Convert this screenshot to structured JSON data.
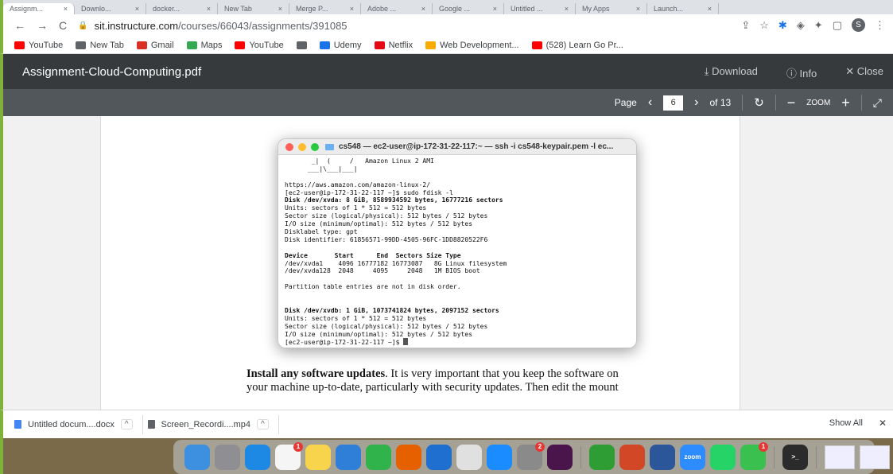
{
  "browser": {
    "tabs": [
      "Assignm...",
      "Downlo...",
      "docker...",
      "New Tab",
      "Merge P...",
      "Adobe ...",
      "Google ...",
      "Untitled ...",
      "My Apps",
      "Launch..."
    ],
    "url_domain": "sit.instructure.com",
    "url_path": "/courses/66043/assignments/391085",
    "avatar_letter": "S",
    "bookmarks": [
      {
        "label": "YouTube",
        "icon": "youtube-icon",
        "color": "#ff0000"
      },
      {
        "label": "New Tab",
        "icon": "chrome-icon",
        "color": "#5f6368"
      },
      {
        "label": "Gmail",
        "icon": "gmail-icon",
        "color": "#d93025"
      },
      {
        "label": "Maps",
        "icon": "maps-icon",
        "color": "#34a853"
      },
      {
        "label": "YouTube",
        "icon": "youtube-icon",
        "color": "#ff0000"
      },
      {
        "label": "",
        "icon": "chrome-icon",
        "color": "#5f6368"
      },
      {
        "label": "Udemy",
        "icon": "udemy-icon",
        "color": "#1a73e8"
      },
      {
        "label": "Netflix",
        "icon": "netflix-icon",
        "color": "#e50914"
      },
      {
        "label": "Web Development...",
        "icon": "bulb-icon",
        "color": "#f9ab00"
      },
      {
        "label": "(528) Learn Go Pr...",
        "icon": "youtube-icon",
        "color": "#ff0000"
      }
    ]
  },
  "viewer": {
    "title": "Assignment-Cloud-Computing.pdf",
    "download": "Download",
    "info": "Info",
    "close": "Close",
    "page_label": "Page",
    "page_current": "6",
    "page_total": "of 13",
    "zoom_label": "ZOOM"
  },
  "terminal": {
    "title": "cs548 — ec2-user@ip-172-31-22-117:~ — ssh -i cs548-keypair.pem -l ec...",
    "lines": [
      "       _|  (     /   Amazon Linux 2 AMI",
      "      ___|\\___|___|",
      "",
      "https://aws.amazon.com/amazon-linux-2/",
      "[ec2-user@ip-172-31-22-117 ~]$ sudo fdisk -l",
      "Disk /dev/xvda: 8 GiB, 8589934592 bytes, 16777216 sectors",
      "Units: sectors of 1 * 512 = 512 bytes",
      "Sector size (logical/physical): 512 bytes / 512 bytes",
      "I/O size (minimum/optimal): 512 bytes / 512 bytes",
      "Disklabel type: gpt",
      "Disk identifier: 61856571-99DD-4505-96FC-1DD8820522F6",
      "",
      "Device       Start      End  Sectors Size Type",
      "/dev/xvda1    4096 16777182 16773087   8G Linux filesystem",
      "/dev/xvda128  2048     4095     2048   1M BIOS boot",
      "",
      "Partition table entries are not in disk order.",
      "",
      "",
      "Disk /dev/xvdb: 1 GiB, 1073741824 bytes, 2097152 sectors",
      "Units: sectors of 1 * 512 = 512 bytes",
      "Sector size (logical/physical): 512 bytes / 512 bytes",
      "I/O size (minimum/optimal): 512 bytes / 512 bytes",
      "[ec2-user@ip-172-31-22-117 ~]$ "
    ],
    "bold_lines": [
      5,
      12,
      19
    ]
  },
  "document": {
    "bold_text": "Install any software updates",
    "text_line1": ".  It is very important that you keep the software on",
    "text_line2": "your machine up-to-date, particularly with security updates.  Then edit the mount"
  },
  "downloads": {
    "items": [
      {
        "label": "Untitled docum....docx",
        "color": "#4285f4"
      },
      {
        "label": "Screen_Recordi....mp4",
        "color": "#5f6368"
      }
    ],
    "show_all": "Show All"
  },
  "dock": {
    "apps": [
      {
        "name": "finder-icon",
        "color": "#3d8fe0",
        "label": ""
      },
      {
        "name": "launchpad-icon",
        "color": "#8e8e93",
        "label": ""
      },
      {
        "name": "safari-icon",
        "color": "#1e88e5",
        "label": ""
      },
      {
        "name": "reminders-icon",
        "color": "#f5f5f5",
        "label": "",
        "badge": "1"
      },
      {
        "name": "notes-icon",
        "color": "#f7d44c",
        "label": ""
      },
      {
        "name": "keynote-icon",
        "color": "#2f7fd8",
        "label": ""
      },
      {
        "name": "numbers-icon",
        "color": "#2fb34a",
        "label": ""
      },
      {
        "name": "firefox-icon",
        "color": "#e66000",
        "label": ""
      },
      {
        "name": "vscode-icon",
        "color": "#1e6fd0",
        "label": ""
      },
      {
        "name": "chrome-icon",
        "color": "#e0e0e0",
        "label": ""
      },
      {
        "name": "appstore-icon",
        "color": "#1a8cff",
        "label": ""
      },
      {
        "name": "system-settings-icon",
        "color": "#8a8a8a",
        "label": "",
        "badge": "2"
      },
      {
        "name": "slack-icon",
        "color": "#4a154b",
        "label": ""
      },
      {
        "name": "utorrent-icon",
        "color": "#2e9e34",
        "label": ""
      },
      {
        "name": "powerpoint-icon",
        "color": "#d24726",
        "label": ""
      },
      {
        "name": "word-icon",
        "color": "#2b579a",
        "label": ""
      },
      {
        "name": "zoom-icon",
        "color": "#2d8cff",
        "label": "zoom"
      },
      {
        "name": "whatsapp-icon",
        "color": "#25d366",
        "label": ""
      },
      {
        "name": "facetime-icon",
        "color": "#39c04f",
        "label": "",
        "badge": "1"
      },
      {
        "name": "terminal-icon",
        "color": "#2b2b2b",
        "label": ">_"
      }
    ],
    "thumbs": 3
  }
}
